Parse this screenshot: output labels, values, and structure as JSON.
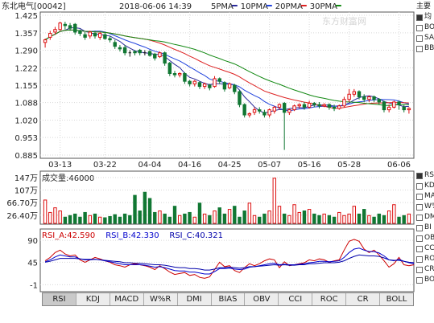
{
  "header": {
    "stock": "东北电气[00042]",
    "datetime": "2018-06-06 14:39",
    "ma": [
      {
        "label": "5PMA",
        "color": "#2a2a9a"
      },
      {
        "label": "10PMA",
        "color": "#2244dd"
      },
      {
        "label": "20PMA",
        "color": "#dd2222"
      },
      {
        "label": "30PMA",
        "color": "#118811"
      }
    ],
    "watermark": "东方财富网"
  },
  "side_main": {
    "title": "主要",
    "items": [
      {
        "label": "均",
        "checked": true
      },
      {
        "label": "BO",
        "checked": false
      },
      {
        "label": "SA",
        "checked": false
      },
      {
        "label": "BB",
        "checked": false
      }
    ]
  },
  "side_sub": {
    "items": [
      {
        "label": "RS",
        "checked": true
      },
      {
        "label": "KD",
        "checked": false
      },
      {
        "label": "MA",
        "checked": false
      },
      {
        "label": "W%",
        "checked": false
      },
      {
        "label": "DM",
        "checked": false
      },
      {
        "label": "BI",
        "checked": false
      },
      {
        "label": "OB",
        "checked": false
      },
      {
        "label": "CC",
        "checked": false
      },
      {
        "label": "RO",
        "checked": false
      },
      {
        "label": "CR",
        "checked": false
      },
      {
        "label": "BO",
        "checked": false
      }
    ]
  },
  "volume_header": "成交量:46000",
  "rsi_header": [
    {
      "text": "RSI_A:42.590",
      "color": "#cc0000"
    },
    {
      "text": "RSI_B:42.330",
      "color": "#0000cc"
    },
    {
      "text": "RSI_C:40.321",
      "color": "#0000aa"
    }
  ],
  "tabs": [
    {
      "label": "RSI",
      "active": true
    },
    {
      "label": "KDJ",
      "active": false
    },
    {
      "label": "MACD",
      "active": false
    },
    {
      "label": "W%R",
      "active": false
    },
    {
      "label": "DMI",
      "active": false
    },
    {
      "label": "BIAS",
      "active": false
    },
    {
      "label": "OBV",
      "active": false
    },
    {
      "label": "CCI",
      "active": false
    },
    {
      "label": "ROC",
      "active": false
    },
    {
      "label": "CR",
      "active": false
    },
    {
      "label": "BOLL",
      "active": false
    }
  ],
  "chart_data": [
    {
      "type": "candlestick",
      "title": "东北电气[00042]",
      "y_ticks": [
        "1.425",
        "1.357",
        "1.290",
        "1.222",
        "1.155",
        "1.088",
        "1.020",
        "0.953",
        "0.885"
      ],
      "ylim": [
        0.885,
        1.425
      ],
      "x_ticks": [
        "03-13",
        "03-22",
        "04-04",
        "04-16",
        "04-25",
        "05-07",
        "05-16",
        "05-28",
        "06-06"
      ],
      "candles": [
        [
          1.32,
          1.33,
          1.3,
          1.335
        ],
        [
          1.34,
          1.355,
          1.33,
          1.365
        ],
        [
          1.36,
          1.37,
          1.35,
          1.38
        ],
        [
          1.37,
          1.395,
          1.365,
          1.4
        ],
        [
          1.39,
          1.385,
          1.37,
          1.4
        ],
        [
          1.385,
          1.375,
          1.365,
          1.395
        ],
        [
          1.39,
          1.36,
          1.35,
          1.395
        ],
        [
          1.365,
          1.355,
          1.345,
          1.37
        ],
        [
          1.35,
          1.34,
          1.33,
          1.36
        ],
        [
          1.345,
          1.36,
          1.335,
          1.365
        ],
        [
          1.355,
          1.345,
          1.335,
          1.365
        ],
        [
          1.34,
          1.355,
          1.33,
          1.36
        ],
        [
          1.35,
          1.335,
          1.33,
          1.36
        ],
        [
          1.335,
          1.33,
          1.32,
          1.345
        ],
        [
          1.32,
          1.305,
          1.295,
          1.33
        ],
        [
          1.3,
          1.295,
          1.285,
          1.31
        ],
        [
          1.3,
          1.28,
          1.27,
          1.31
        ],
        [
          1.28,
          1.28,
          1.265,
          1.29
        ],
        [
          1.285,
          1.28,
          1.27,
          1.29
        ],
        [
          1.29,
          1.28,
          1.27,
          1.295
        ],
        [
          1.28,
          1.28,
          1.27,
          1.29
        ],
        [
          1.285,
          1.27,
          1.265,
          1.29
        ],
        [
          1.275,
          1.26,
          1.25,
          1.28
        ],
        [
          1.265,
          1.28,
          1.26,
          1.285
        ],
        [
          1.28,
          1.24,
          1.23,
          1.285
        ],
        [
          1.24,
          1.2,
          1.19,
          1.245
        ],
        [
          1.2,
          1.195,
          1.185,
          1.21
        ],
        [
          1.195,
          1.2,
          1.185,
          1.205
        ],
        [
          1.2,
          1.17,
          1.16,
          1.205
        ],
        [
          1.17,
          1.16,
          1.15,
          1.175
        ],
        [
          1.16,
          1.17,
          1.15,
          1.175
        ],
        [
          1.165,
          1.15,
          1.14,
          1.17
        ],
        [
          1.15,
          1.16,
          1.14,
          1.165
        ],
        [
          1.155,
          1.145,
          1.135,
          1.16
        ],
        [
          1.15,
          1.18,
          1.145,
          1.19
        ],
        [
          1.18,
          1.17,
          1.16,
          1.185
        ],
        [
          1.165,
          1.14,
          1.13,
          1.17
        ],
        [
          1.145,
          1.16,
          1.14,
          1.165
        ],
        [
          1.155,
          1.13,
          1.12,
          1.16
        ],
        [
          1.13,
          1.08,
          1.07,
          1.135
        ],
        [
          1.08,
          1.04,
          1.03,
          1.085
        ],
        [
          1.04,
          1.045,
          1.03,
          1.05
        ],
        [
          1.05,
          1.06,
          1.04,
          1.07
        ],
        [
          1.06,
          1.055,
          1.045,
          1.07
        ],
        [
          1.05,
          1.04,
          1.03,
          1.06
        ],
        [
          1.04,
          1.06,
          1.03,
          1.065
        ],
        [
          1.055,
          1.07,
          1.045,
          1.075
        ],
        [
          1.07,
          1.08,
          1.06,
          1.085
        ],
        [
          1.085,
          1.05,
          0.905,
          1.09
        ],
        [
          1.05,
          1.06,
          1.04,
          1.065
        ],
        [
          1.06,
          1.075,
          1.055,
          1.08
        ],
        [
          1.075,
          1.08,
          1.065,
          1.085
        ],
        [
          1.08,
          1.07,
          1.06,
          1.09
        ],
        [
          1.07,
          1.085,
          1.065,
          1.095
        ],
        [
          1.085,
          1.08,
          1.07,
          1.09
        ],
        [
          1.08,
          1.075,
          1.065,
          1.09
        ],
        [
          1.075,
          1.08,
          1.07,
          1.085
        ],
        [
          1.08,
          1.07,
          1.06,
          1.085
        ],
        [
          1.07,
          1.065,
          1.055,
          1.08
        ],
        [
          1.065,
          1.075,
          1.06,
          1.08
        ],
        [
          1.075,
          1.1,
          1.07,
          1.11
        ],
        [
          1.1,
          1.12,
          1.09,
          1.14
        ],
        [
          1.12,
          1.13,
          1.11,
          1.14
        ],
        [
          1.13,
          1.11,
          1.1,
          1.135
        ],
        [
          1.11,
          1.1,
          1.09,
          1.12
        ],
        [
          1.1,
          1.11,
          1.09,
          1.115
        ],
        [
          1.11,
          1.1,
          1.09,
          1.115
        ],
        [
          1.1,
          1.09,
          1.08,
          1.105
        ],
        [
          1.09,
          1.06,
          1.05,
          1.095
        ],
        [
          1.06,
          1.07,
          1.05,
          1.08
        ],
        [
          1.07,
          1.09,
          1.065,
          1.095
        ],
        [
          1.09,
          1.08,
          1.06,
          1.095
        ],
        [
          1.07,
          1.06,
          1.05,
          1.08
        ],
        [
          1.06,
          1.065,
          1.045,
          1.07
        ]
      ],
      "ma_series": [
        {
          "name": "5PMA",
          "color": "#2a2a9a"
        },
        {
          "name": "10PMA",
          "color": "#2244dd"
        },
        {
          "name": "20PMA",
          "color": "#dd2222"
        },
        {
          "name": "30PMA",
          "color": "#118811"
        }
      ]
    },
    {
      "type": "bar",
      "title": "成交量:46000",
      "y_ticks": [
        "147万",
        "107万",
        "66.70万",
        "26.40万"
      ],
      "y_tick_values": [
        147,
        107,
        66.7,
        26.4
      ],
      "ylim": [
        0,
        160
      ],
      "values": [
        75,
        35,
        50,
        40,
        20,
        25,
        30,
        20,
        35,
        25,
        30,
        20,
        18,
        22,
        28,
        20,
        30,
        25,
        90,
        40,
        100,
        80,
        35,
        40,
        30,
        20,
        55,
        25,
        30,
        35,
        20,
        65,
        30,
        25,
        40,
        50,
        30,
        45,
        55,
        20,
        40,
        65,
        25,
        20,
        30,
        40,
        145,
        55,
        30,
        25,
        60,
        35,
        40,
        45,
        30,
        25,
        30,
        25,
        20,
        35,
        25,
        30,
        55,
        30,
        45,
        25,
        20,
        30,
        25,
        40,
        60,
        20,
        25,
        30
      ]
    },
    {
      "type": "line",
      "title": "RSI",
      "y_ticks": [
        "90",
        "45",
        "-1"
      ],
      "ylim": [
        -12,
        110
      ],
      "series": [
        {
          "name": "RSI_A",
          "color": "#cc0000",
          "values": [
            48,
            55,
            65,
            70,
            62,
            58,
            60,
            50,
            45,
            50,
            55,
            52,
            48,
            45,
            40,
            38,
            35,
            40,
            42,
            40,
            38,
            35,
            30,
            38,
            32,
            25,
            20,
            22,
            24,
            18,
            20,
            14,
            12,
            15,
            30,
            45,
            36,
            38,
            28,
            24,
            34,
            42,
            38,
            42,
            48,
            52,
            50,
            34,
            46,
            38,
            40,
            42,
            44,
            50,
            48,
            52,
            50,
            45,
            48,
            50,
            70,
            88,
            92,
            88,
            72,
            65,
            70,
            60,
            48,
            35,
            42,
            55,
            40,
            38,
            40
          ]
        },
        {
          "name": "RSI_B",
          "color": "#0000cc",
          "values": [
            46,
            50,
            56,
            60,
            58,
            56,
            56,
            52,
            50,
            50,
            51,
            50,
            48,
            46,
            44,
            42,
            40,
            40,
            40,
            40,
            39,
            37,
            35,
            36,
            34,
            31,
            28,
            27,
            27,
            25,
            25,
            23,
            21,
            21,
            26,
            32,
            32,
            33,
            31,
            30,
            31,
            35,
            36,
            38,
            40,
            42,
            43,
            40,
            41,
            40,
            40,
            41,
            42,
            44,
            45,
            47,
            47,
            46,
            47,
            48,
            55,
            65,
            72,
            74,
            70,
            67,
            67,
            64,
            58,
            50,
            48,
            51,
            47,
            44,
            42
          ]
        },
        {
          "name": "RSI_C",
          "color": "#0000aa",
          "values": [
            45,
            47,
            50,
            53,
            53,
            53,
            53,
            52,
            51,
            51,
            51,
            50,
            49,
            48,
            47,
            46,
            44,
            44,
            43,
            43,
            42,
            41,
            40,
            40,
            39,
            37,
            35,
            34,
            34,
            32,
            32,
            31,
            29,
            29,
            31,
            34,
            34,
            35,
            34,
            33,
            34,
            36,
            36,
            37,
            38,
            39,
            40,
            39,
            40,
            39,
            39,
            40,
            40,
            42,
            42,
            43,
            44,
            44,
            44,
            45,
            48,
            53,
            57,
            60,
            59,
            58,
            58,
            57,
            54,
            50,
            49,
            49,
            47,
            45,
            44
          ]
        }
      ]
    }
  ]
}
